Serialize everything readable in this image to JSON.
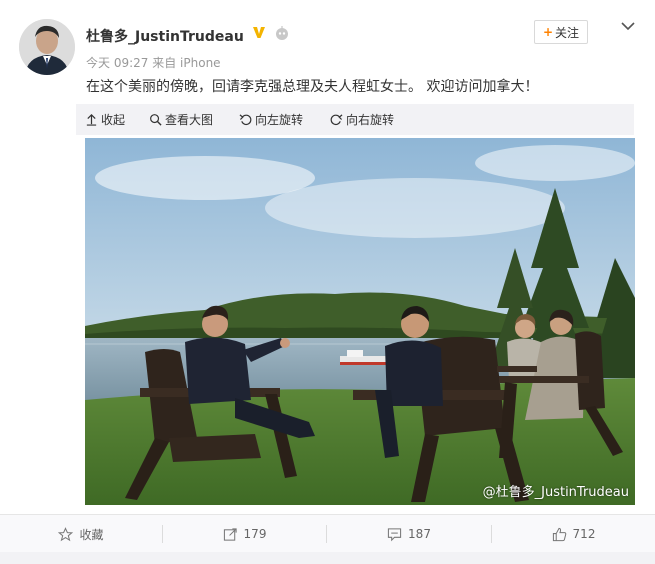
{
  "post": {
    "username": "杜鲁多_JustinTrudeau",
    "verified_badge": "V",
    "time": "今天 09:27",
    "source": "来自 iPhone",
    "follow_label": "关注",
    "follow_plus": "+",
    "text": "在这个美丽的傍晚，回请李克强总理及夫人程虹女士。 欢迎访问加拿大！"
  },
  "media_toolbar": {
    "collapse": "收起",
    "view_large": "查看大图",
    "rotate_left": "向左旋转",
    "rotate_right": "向右旋转"
  },
  "photo": {
    "watermark": "@杜鲁多_JustinTrudeau"
  },
  "actions": {
    "favorite": "收藏",
    "repost": "179",
    "comment": "187",
    "like": "712"
  },
  "colors": {
    "accent": "#ff8200",
    "verified": "#f4b400"
  },
  "icons": [
    "arrow-up-icon",
    "magnifier-icon",
    "rotate-left-icon",
    "rotate-right-icon",
    "star-icon",
    "repost-icon",
    "comment-icon",
    "thumbs-up-icon",
    "chevron-down-icon",
    "robot-icon"
  ]
}
